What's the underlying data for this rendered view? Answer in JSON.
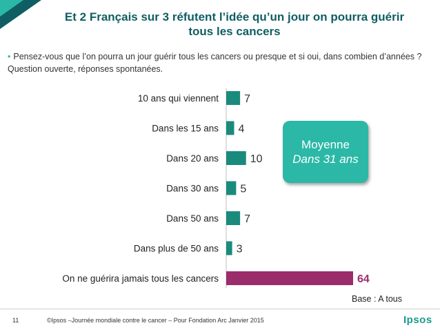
{
  "title": {
    "line1": "Et 2 Français sur 3 réfutent l’idée qu’un jour on pourra guérir",
    "line2": "tous les cancers"
  },
  "question": {
    "text": "Pensez-vous que l’on pourra un jour guérir tous les cancers ou presque et si oui, dans combien d’années ?",
    "note": "Question ouverte, réponses spontanées."
  },
  "average_box": {
    "label": "Moyenne",
    "value": "Dans 31 ans"
  },
  "base_note": "Base : A tous",
  "footer": {
    "page_number": "11",
    "copyright": "©Ipsos –Journée mondiale contre le cancer – Pour Fondation Arc  Janvier 2015",
    "logo": "Ipsos"
  },
  "colors": {
    "bar_default": "#1a8a7c",
    "bar_highlight": "#9b2d6b",
    "label_default": "#333333",
    "label_highlight": "#9b2d6b",
    "accent": "#2bb8a6",
    "title": "#0f5e63"
  },
  "chart_data": {
    "type": "bar",
    "orientation": "horizontal",
    "categories": [
      "10 ans qui viennent",
      "Dans les 15 ans",
      "Dans 20 ans",
      "Dans 30 ans",
      "Dans 50 ans",
      "Dans plus de 50 ans",
      "On ne guérira jamais tous les cancers"
    ],
    "values": [
      7,
      4,
      10,
      5,
      7,
      3,
      64
    ],
    "highlight_index": 6,
    "xlim": [
      0,
      64
    ],
    "grid": false,
    "title": "",
    "xlabel": "",
    "ylabel": ""
  }
}
